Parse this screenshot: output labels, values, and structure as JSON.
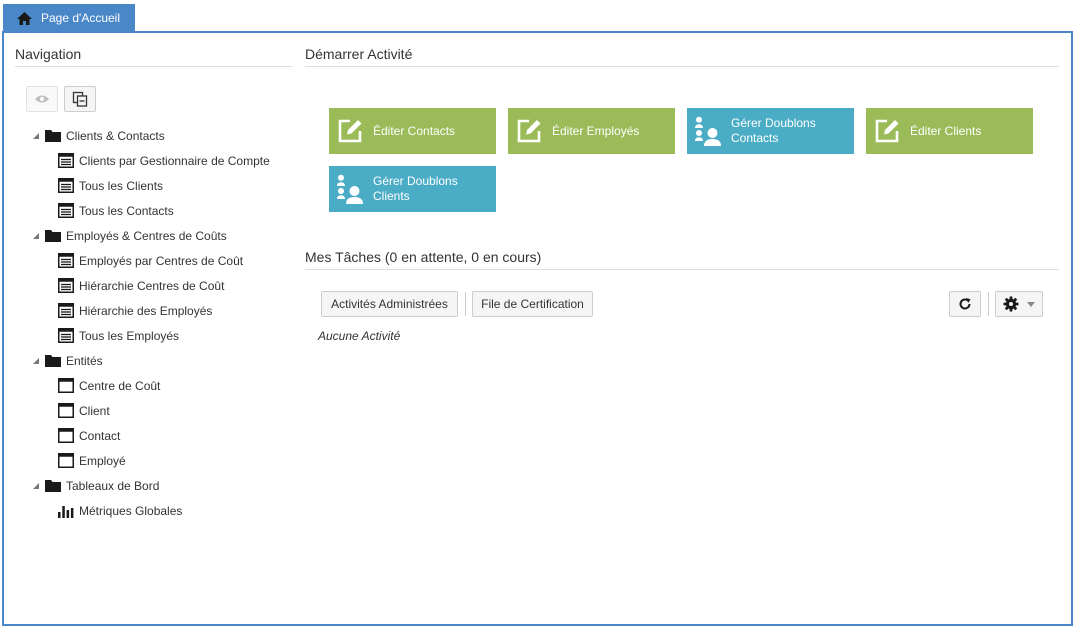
{
  "tab": {
    "label": "Page d'Accueil",
    "icon": "home-icon"
  },
  "navigation": {
    "title": "Navigation",
    "tools": [
      {
        "icon": "eye-icon",
        "disabled": true
      },
      {
        "icon": "collapse-all-icon",
        "disabled": false
      }
    ],
    "groups": [
      {
        "label": "Clients & Contacts",
        "items": [
          {
            "label": "Clients par Gestionnaire de Compte",
            "icon": "list-icon"
          },
          {
            "label": "Tous les Clients",
            "icon": "list-icon"
          },
          {
            "label": "Tous les Contacts",
            "icon": "list-icon"
          }
        ]
      },
      {
        "label": "Employés & Centres de Coûts",
        "items": [
          {
            "label": "Employés par Centres de Coût",
            "icon": "list-icon"
          },
          {
            "label": "Hiérarchie Centres de Coût",
            "icon": "list-icon"
          },
          {
            "label": "Hiérarchie des Employés",
            "icon": "list-icon"
          },
          {
            "label": "Tous les Employés",
            "icon": "list-icon"
          }
        ]
      },
      {
        "label": "Entités",
        "items": [
          {
            "label": "Centre de Coût",
            "icon": "window-icon"
          },
          {
            "label": "Client",
            "icon": "window-icon"
          },
          {
            "label": "Contact",
            "icon": "window-icon"
          },
          {
            "label": "Employé",
            "icon": "window-icon"
          }
        ]
      },
      {
        "label": "Tableaux de Bord",
        "items": [
          {
            "label": "Métriques Globales",
            "icon": "bar-chart-icon"
          }
        ]
      }
    ]
  },
  "start_activity": {
    "title": "Démarrer Activité",
    "tiles": [
      {
        "label": "Éditer Contacts",
        "icon": "edit-icon",
        "color": "#9bbb59"
      },
      {
        "label": "Éditer Employés",
        "icon": "edit-icon",
        "color": "#9bbb59"
      },
      {
        "label": "Gérer Doublons Contacts",
        "icon": "users-icon",
        "color": "#4bacc6"
      },
      {
        "label": "Éditer Clients",
        "icon": "edit-icon",
        "color": "#9bbb59"
      },
      {
        "label": "Gérer Doublons Clients",
        "icon": "users-icon",
        "color": "#4bacc6"
      }
    ]
  },
  "tasks": {
    "title": "Mes Tâches (0 en attente, 0 en cours)",
    "administered_label": "Activités Administrées",
    "certification_label": "File de Certification",
    "refresh_icon": "refresh-icon",
    "settings_icon": "gear-icon",
    "empty_label": "Aucune Activité"
  },
  "colors": {
    "accent": "#4a87c8",
    "green_tile": "#9bbb59",
    "blue_tile": "#4bacc6"
  }
}
